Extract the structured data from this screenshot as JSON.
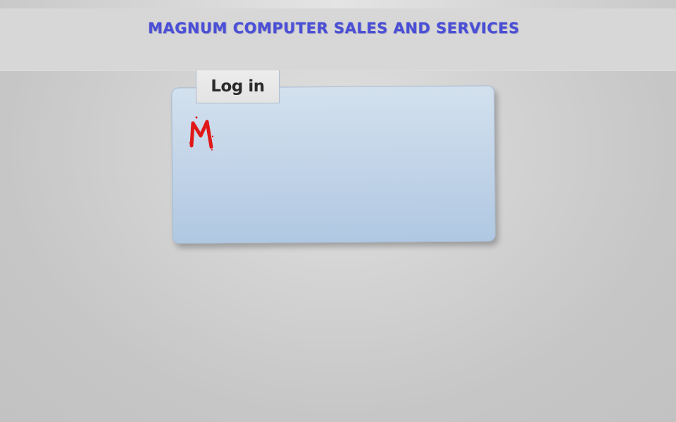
{
  "header": {
    "title": "MAGNUM COMPUTER SALES AND SERVICES"
  },
  "login": {
    "tab_label": "Log in",
    "logo_letter": "M"
  },
  "colors": {
    "title": "#4a4fd6",
    "panel": "#c2d4e8",
    "logo": "#e01818"
  },
  "icons": {
    "logo": "magnum-m-logo-icon"
  }
}
